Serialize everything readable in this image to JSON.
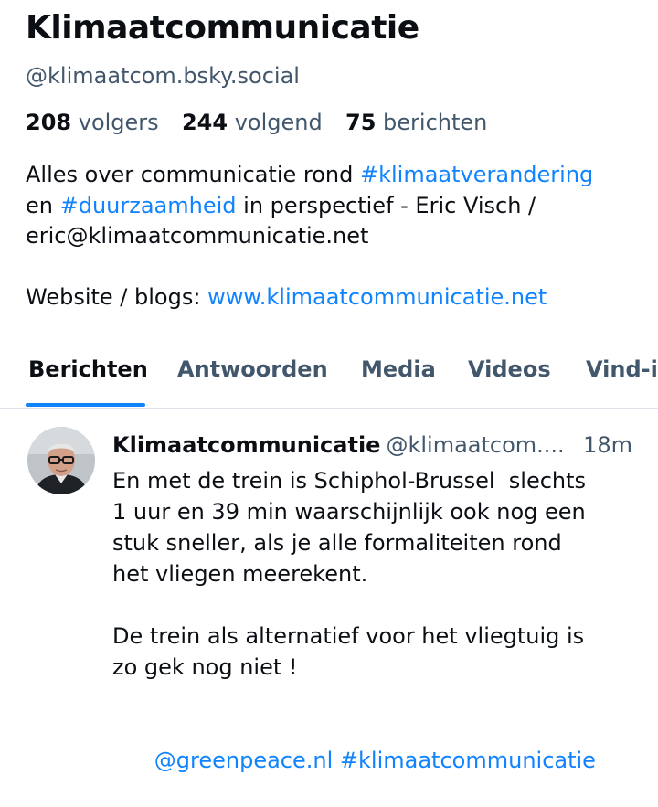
{
  "profile": {
    "display_name": "Klimaatcommunicatie",
    "handle": "@klimaatcom.bsky.social",
    "stats": {
      "followers_count": "208",
      "followers_label": "volgers",
      "following_count": "244",
      "following_label": "volgend",
      "posts_count": "75",
      "posts_label": "berichten"
    },
    "bio": {
      "line1_text": "Alles over communicatie rond ",
      "line1_tag": "#klimaatverandering",
      "line2_pre": "en ",
      "line2_tag": "#duurzaamheid",
      "line2_post": " in perspectief - Eric Visch /",
      "line3": "eric@klimaatcommunicatie.net",
      "website_label": "Website / blogs: ",
      "website_link": "www.klimaatcommunicatie.net"
    }
  },
  "tabs": [
    {
      "label": "Berichten",
      "active": true
    },
    {
      "label": "Antwoorden",
      "active": false
    },
    {
      "label": "Media",
      "active": false
    },
    {
      "label": "Videos",
      "active": false
    },
    {
      "label": "Vind-i",
      "active": false
    }
  ],
  "post": {
    "author": "Klimaatcommunicatie",
    "handle": "@klimaatcom....",
    "time": "18m",
    "lines": [
      "En met de trein is Schiphol-Brussel  slechts",
      "1 uur en 39 min waarschijnlijk ook nog een",
      "stuk sneller, als je alle formaliteiten rond",
      "het vliegen meerekent.",
      "",
      "De trein als alternatief voor het vliegtuig is",
      "zo gek nog niet !",
      ""
    ],
    "mention": "@greenpeace.nl",
    "hashtag": "#klimaatcommunicatie"
  },
  "colors": {
    "accent": "#1083fe",
    "text": "#0b0f14",
    "muted": "#42576c",
    "divider": "#dfe4ea"
  }
}
